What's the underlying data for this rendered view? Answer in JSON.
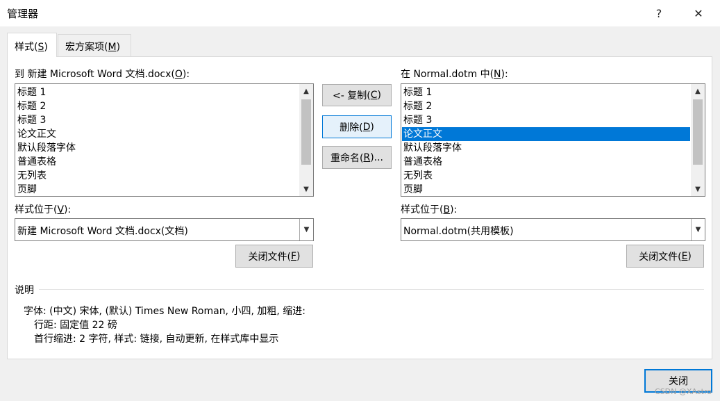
{
  "window": {
    "title": "管理器",
    "help_glyph": "?",
    "close_glyph": "✕"
  },
  "tabs": [
    {
      "text": "样式(",
      "key": "S",
      "end": ")"
    },
    {
      "text": "宏方案项(",
      "key": "M",
      "end": ")"
    }
  ],
  "left": {
    "list_label": {
      "text": "到 新建 Microsoft Word 文档.docx(",
      "key": "O",
      "end": "):"
    },
    "items": [
      "标题 1",
      "标题 2",
      "标题 3",
      "论文正文",
      "默认段落字体",
      "普通表格",
      "无列表",
      "页脚"
    ],
    "styles_in_label": {
      "text": "样式位于(",
      "key": "V",
      "end": "):"
    },
    "combo_value": "新建 Microsoft Word 文档.docx(文档)",
    "close_file": {
      "text": "关闭文件(",
      "key": "F",
      "end": ")"
    }
  },
  "right": {
    "list_label": {
      "text": "在 Normal.dotm 中(",
      "key": "N",
      "end": "):"
    },
    "items": [
      "标题 1",
      "标题 2",
      "标题 3",
      "论文正文",
      "默认段落字体",
      "普通表格",
      "无列表",
      "页脚"
    ],
    "selected_item": "论文正文",
    "styles_in_label": {
      "text": "样式位于(",
      "key": "B",
      "end": "):"
    },
    "combo_value": "Normal.dotm(共用模板)",
    "close_file": {
      "text": "关闭文件(",
      "key": "E",
      "end": ")"
    }
  },
  "middle": {
    "copy": {
      "text": "<- 复制(",
      "key": "C",
      "end": ")"
    },
    "delete": {
      "text": "删除(",
      "key": "D",
      "end": ")"
    },
    "rename": {
      "text": "重命名(",
      "key": "R",
      "end": ")..."
    }
  },
  "description": {
    "label": "说明",
    "lines": [
      "字体: (中文) 宋体, (默认) Times New Roman, 小四, 加粗, 缩进:",
      "行距: 固定值 22 磅",
      "首行缩进:  2 字符, 样式: 链接, 自动更新, 在样式库中显示"
    ]
  },
  "footer": {
    "close_button": "关闭",
    "watermark": "CSDN @XAstro"
  },
  "colors": {
    "selection": "#0078d7",
    "panel_bg": "#ffffff",
    "dialog_bg": "#f0f0f0"
  }
}
